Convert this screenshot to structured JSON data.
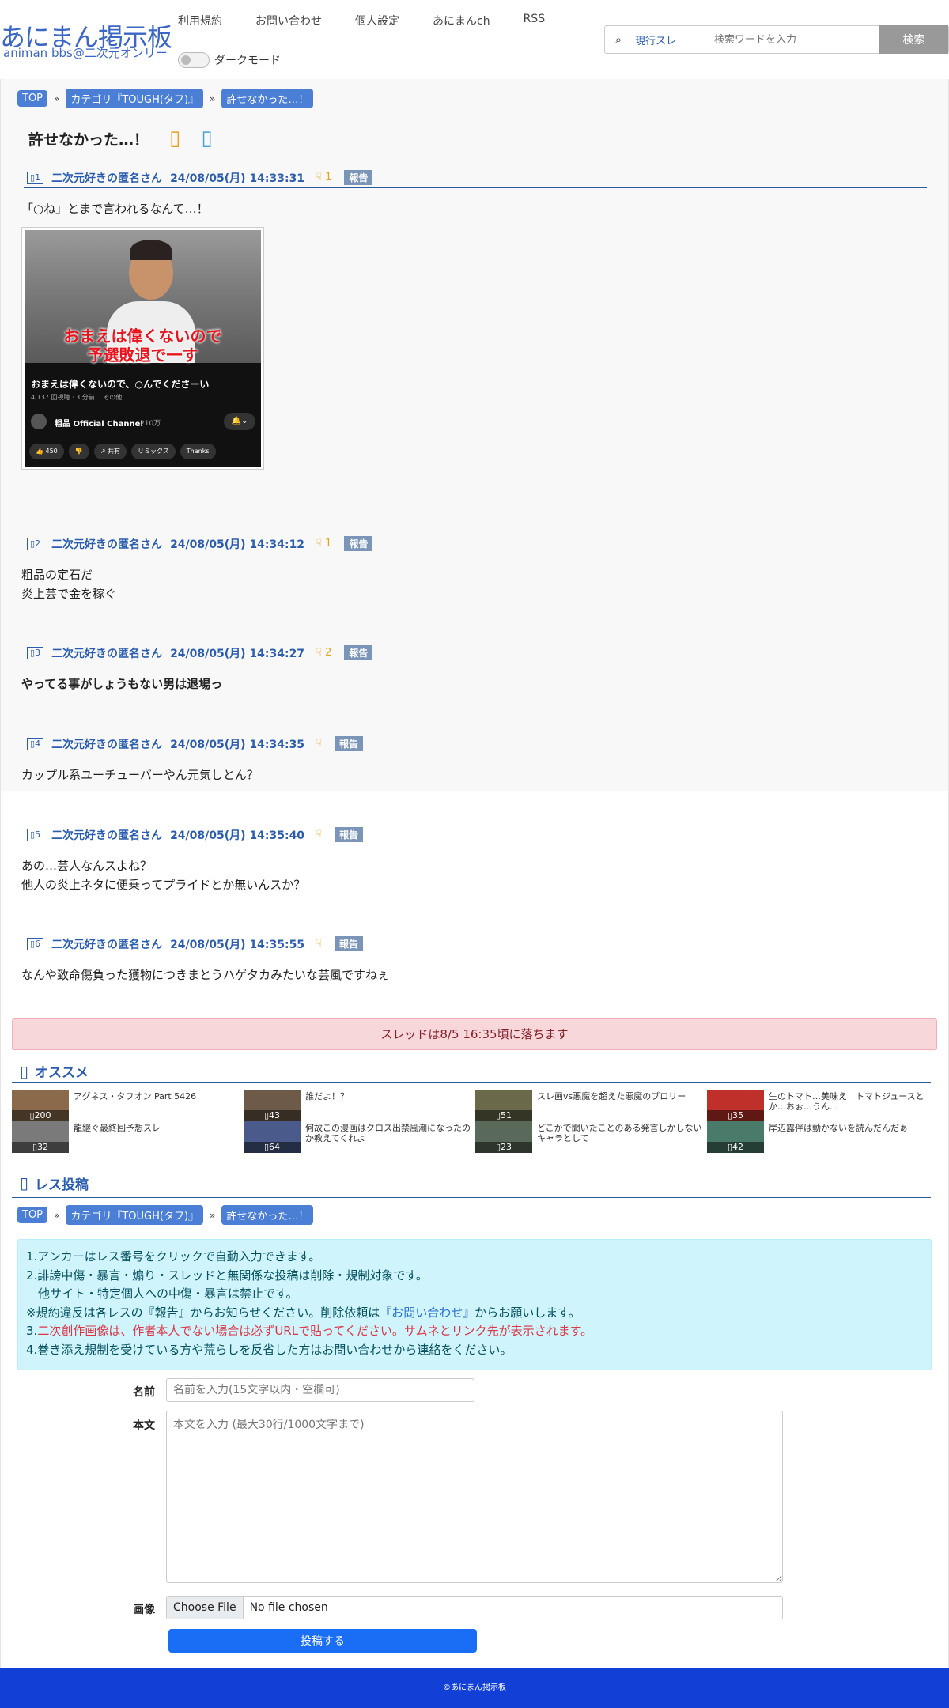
{
  "site": {
    "logo": "あにまん掲示板",
    "subtitle": "animan bbs@二次元オンリー"
  },
  "nav": [
    "利用規約",
    "お問い合わせ",
    "個人設定",
    "あにまんch",
    "RSS"
  ],
  "dark_mode": {
    "label": "ダークモード",
    "enabled": false
  },
  "search": {
    "icon": "search-icon",
    "scope": "現行スレ",
    "placeholder": "検索ワードを入力",
    "button": "検索"
  },
  "breadcrumb": [
    "TOP",
    "カテゴリ『TOUGH(タフ)』",
    "許せなかった…！"
  ],
  "breadcrumb_sep": "»",
  "thread": {
    "title": "許せなかった…！",
    "icons": [
      "favorite-icon",
      "share-icon"
    ]
  },
  "posts": [
    {
      "num": "1",
      "name": "二次元好きの匿名さん",
      "date": "24/08/05(月) 14:33:31",
      "good": "1",
      "report": "報告",
      "lines": [
        "「○ね」とまで言われるなんて…！"
      ],
      "bold": false
    },
    {
      "num": "2",
      "name": "二次元好きの匿名さん",
      "date": "24/08/05(月) 14:34:12",
      "good": "1",
      "report": "報告",
      "lines": [
        "粗品の定石だ",
        "炎上芸で金を稼ぐ"
      ],
      "bold": false
    },
    {
      "num": "3",
      "name": "二次元好きの匿名さん",
      "date": "24/08/05(月) 14:34:27",
      "good": "2",
      "report": "報告",
      "lines": [
        "やってる事がしょうもない男は退場っ"
      ],
      "bold": true
    },
    {
      "num": "4",
      "name": "二次元好きの匿名さん",
      "date": "24/08/05(月) 14:34:35",
      "good": "",
      "report": "報告",
      "lines": [
        "カップル系ユーチューバーやん元気しとん？"
      ],
      "bold": false
    },
    {
      "num": "5",
      "name": "二次元好きの匿名さん",
      "date": "24/08/05(月) 14:35:40",
      "good": "",
      "report": "報告",
      "lines": [
        "あの…芸人なんスよね？",
        "他人の炎上ネタに便乗ってプライドとか無いんスか？"
      ],
      "bold": false
    },
    {
      "num": "6",
      "name": "二次元好きの匿名さん",
      "date": "24/08/05(月) 14:35:55",
      "good": "",
      "report": "報告",
      "lines": [
        "なんや致命傷負った獲物につきまとうハゲタカみたいな芸風ですねぇ"
      ],
      "bold": false
    }
  ],
  "post_icon": "chat-bubble-icon",
  "good_icon": "good-hand-icon",
  "thumbnail": {
    "caption_top": "おまえは偉くないので",
    "caption_bottom": "予選敗退で一す",
    "video_title": "おまえは偉くないので、○んでくださーい",
    "video_meta": "4,137 回視聴 · 3 分前 …その他",
    "channel": "粗品 Official Channel",
    "subscribers": "210万",
    "buttons": [
      "👍 450",
      "👎",
      "↗ 共有",
      "リミックス",
      "Thanks"
    ]
  },
  "fall_notice": "スレッドは8/5 16:35頃に落ちます",
  "recommend": {
    "title": "オススメ",
    "icon": "recommend-icon",
    "items": [
      {
        "title": "アグネス・タフオン Part 5426",
        "count": "200",
        "color": "#8a6a4a"
      },
      {
        "title": "誰だよ！？",
        "count": "43",
        "color": "#6d5a48"
      },
      {
        "title": "スレ画vs悪魔を超えた悪魔のブロリー",
        "count": "51",
        "color": "#6a6a4a"
      },
      {
        "title": "生のトマト…美味え　トマトジュースとか…おぉ…うん…",
        "count": "35",
        "color": "#c0302a"
      },
      {
        "title": "龍継ぐ最終回予想スレ",
        "count": "32",
        "color": "#7a7a7a"
      },
      {
        "title": "何故この漫画はクロス出禁風潮になったのか教えてくれよ",
        "count": "64",
        "color": "#4a5a8a"
      },
      {
        "title": "どこかで聞いたことのある発言しかしないキャラとして",
        "count": "23",
        "color": "#5a6a5a"
      },
      {
        "title": "岸辺露伴は動かないを読んだんだぁ",
        "count": "42",
        "color": "#4a7a6a"
      }
    ]
  },
  "reply": {
    "title": "レス投稿",
    "icon": "reply-icon",
    "rules": [
      {
        "parts": [
          {
            "t": "1.アンカーはレス番号をクリックで自動入力できます。",
            "c": ""
          }
        ]
      },
      {
        "parts": [
          {
            "t": "2.誹謗中傷・暴言・煽り・スレッドと無関係な投稿は削除・規制対象です。",
            "c": ""
          }
        ]
      },
      {
        "parts": [
          {
            "t": "　他サイト・特定個人への中傷・暴言は禁止です。",
            "c": ""
          }
        ]
      },
      {
        "parts": [
          {
            "t": "※規約違反は各レスの『報告』からお知らせください。削除依頼は",
            "c": ""
          },
          {
            "t": "『お問い合わせ』",
            "c": "blue"
          },
          {
            "t": "からお願いします。",
            "c": ""
          }
        ]
      },
      {
        "parts": [
          {
            "t": "3.",
            "c": ""
          },
          {
            "t": "二次創作画像は、作者本人でない場合は必ずURLで貼ってください。サムネとリンク先が表示されます。",
            "c": "red"
          }
        ]
      },
      {
        "parts": [
          {
            "t": "4.巻き添え規制を受けている方や荒らしを反省した方はお問い合わせから連絡をください。",
            "c": ""
          }
        ]
      }
    ],
    "name_label": "名前",
    "name_placeholder": "名前を入力(15文字以内・空欄可)",
    "body_label": "本文",
    "body_placeholder": "本文を入力 (最大30行/1000文字まで)",
    "image_label": "画像",
    "file_button": "Choose File",
    "file_name": "No file chosen",
    "submit": "投稿する"
  },
  "footer": "©あにまん掲示板"
}
